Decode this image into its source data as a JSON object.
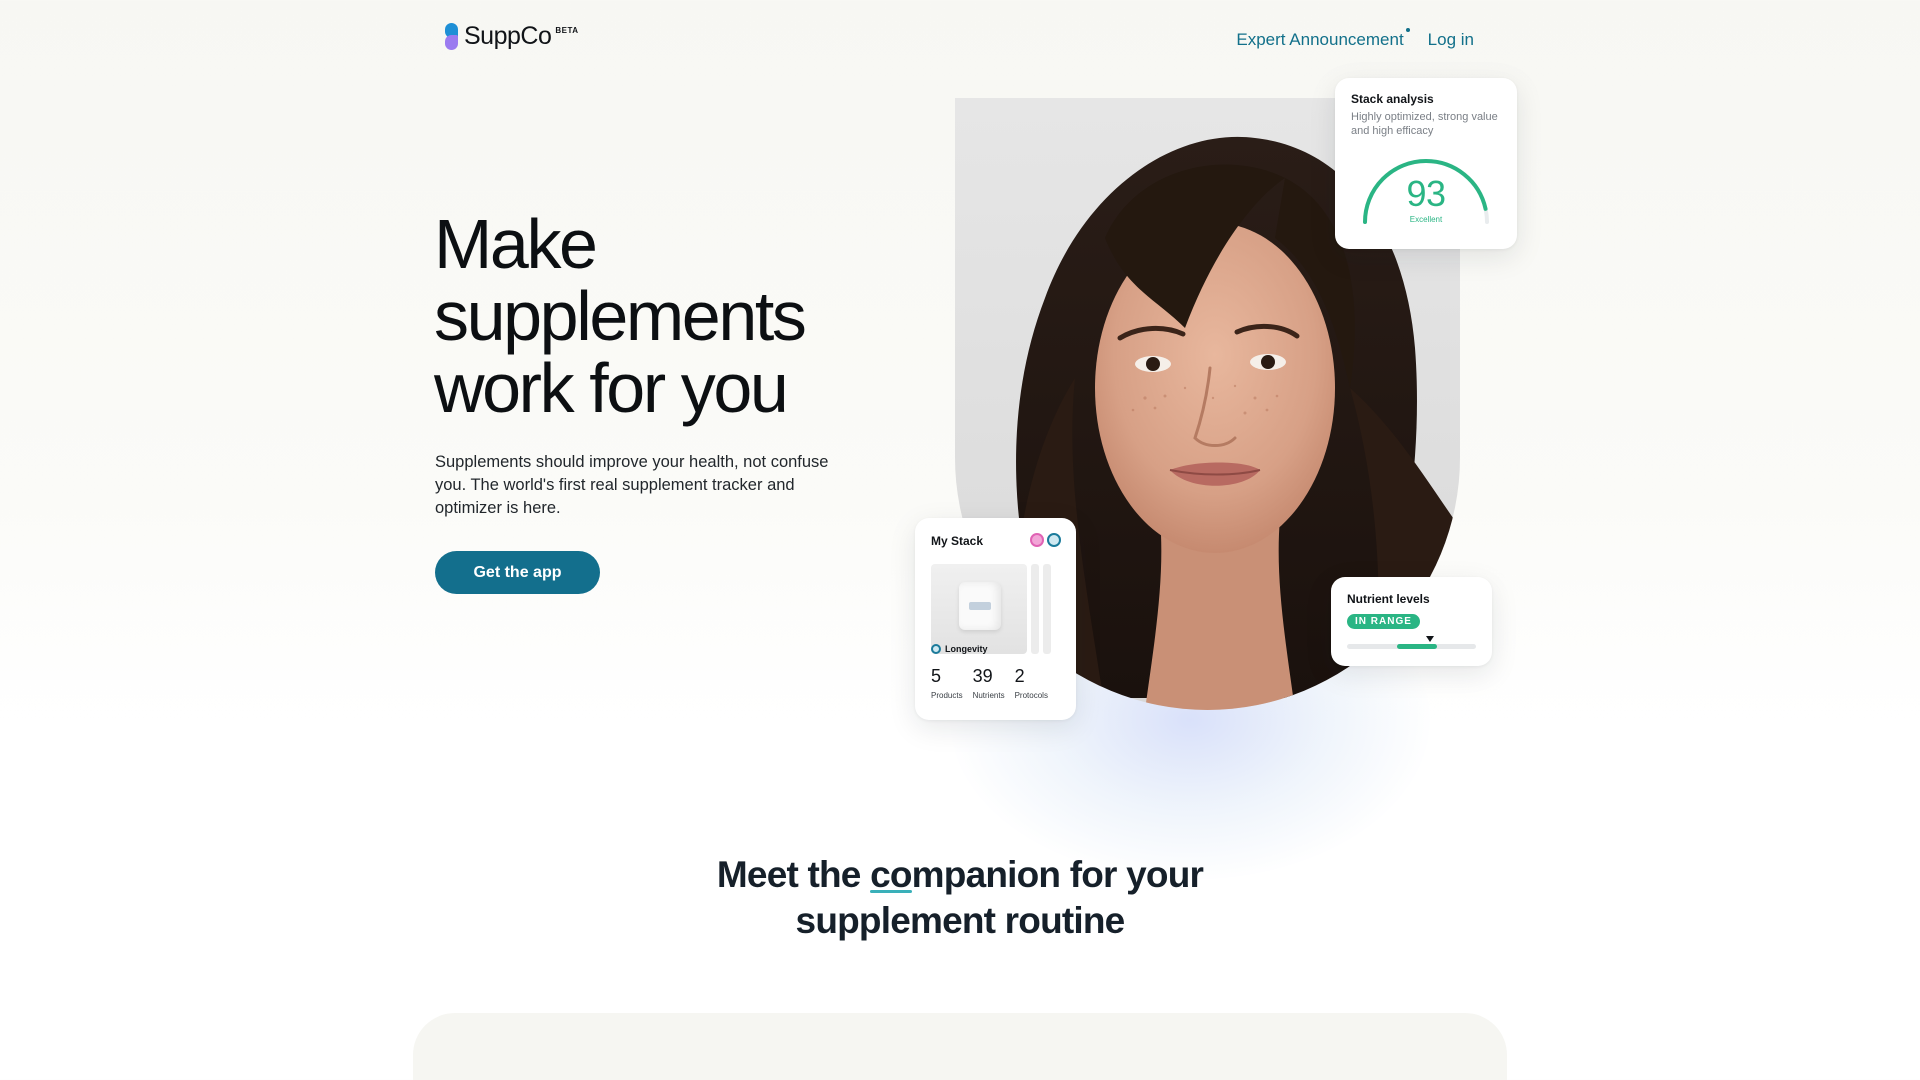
{
  "nav": {
    "brand": "SuppCo",
    "beta": "BETA",
    "links": [
      "Expert Announcement",
      "Log in"
    ]
  },
  "hero": {
    "title_lines": [
      "Make",
      "supplements",
      "work for you"
    ],
    "subtitle": "Supplements should improve your health, not confuse you. The world's first real supplement tracker and optimizer is here.",
    "cta": "Get the app"
  },
  "analysis_card": {
    "title": "Stack analysis",
    "description": "Highly optimized, strong value and high efficacy",
    "score": "93",
    "score_label": "Excellent",
    "score_value": 93,
    "accent": "#2ab584"
  },
  "stack_card": {
    "title": "My Stack",
    "protocol": "Longevity",
    "stats": [
      {
        "value": "5",
        "label": "Products"
      },
      {
        "value": "39",
        "label": "Nutrients"
      },
      {
        "value": "2",
        "label": "Protocols"
      }
    ]
  },
  "nutrient_card": {
    "title": "Nutrient levels",
    "status": "IN RANGE",
    "range_low": 0.39,
    "range_high": 0.7,
    "marker": 0.64
  },
  "section": {
    "title_pre": "Meet the ",
    "title_underlined": "co",
    "title_post": "mpanion for your",
    "title_line2": "supplement routine"
  },
  "colors": {
    "brand_teal": "#136f8d",
    "link": "#12708a",
    "success": "#2ab584"
  }
}
